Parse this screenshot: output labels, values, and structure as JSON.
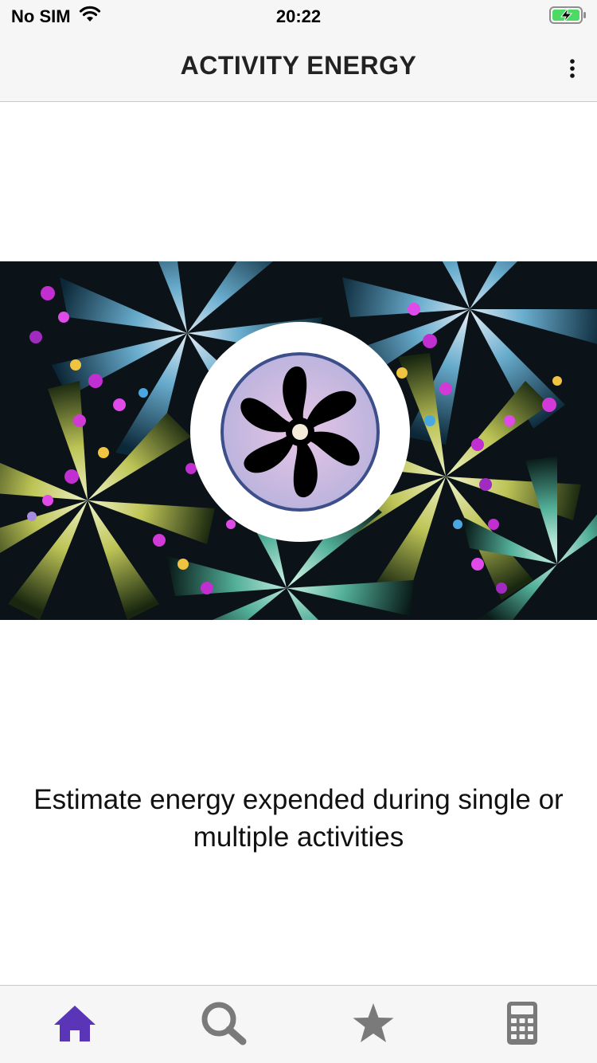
{
  "status_bar": {
    "carrier": "No SIM",
    "time": "20:22"
  },
  "header": {
    "title": "ACTIVITY ENERGY"
  },
  "hero": {
    "icons": [
      "fractal-background",
      "app-logo-icon"
    ]
  },
  "main": {
    "description": "Estimate energy expended during single or multiple activities"
  },
  "bottom_nav": {
    "items": [
      {
        "name": "home",
        "icon": "home-icon",
        "active": true
      },
      {
        "name": "search",
        "icon": "search-icon",
        "active": false
      },
      {
        "name": "favorites",
        "icon": "star-icon",
        "active": false
      },
      {
        "name": "calculator",
        "icon": "calculator-icon",
        "active": false
      }
    ]
  },
  "colors": {
    "active": "#5a35b8",
    "inactive": "#7a7a7a",
    "bar_background": "#f6f6f6",
    "battery_fill": "#4cd964"
  }
}
